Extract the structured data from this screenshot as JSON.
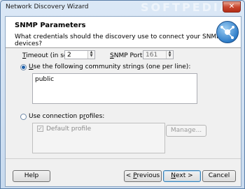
{
  "window": {
    "title": "Network Discovery Wizard",
    "watermark": "SOFTPEDIA",
    "close_glyph": "✕"
  },
  "header": {
    "title": "SNMP Parameters",
    "subtitle": "What credentials should the discovery use to connect your SNMP devices?"
  },
  "timeout": {
    "label_prefix": "",
    "label_u": "T",
    "label_rest": "imeout (in sec):",
    "value": "2"
  },
  "snmp_port": {
    "label_u": "S",
    "label_rest": "NMP Port:",
    "value": "161"
  },
  "community": {
    "label_u": "U",
    "label_rest": "se the following community strings (one per line):",
    "value": "public"
  },
  "profiles": {
    "label_pre": "Use connection p",
    "label_u": "r",
    "label_rest": "ofiles:",
    "items": [
      {
        "label": "Default profile",
        "checked": true
      }
    ],
    "manage_label": "Manage..."
  },
  "buttons": {
    "help": "Help",
    "previous_u": "P",
    "previous_rest": "revious",
    "previous_arrow": "<",
    "next_u": "N",
    "next_rest": "ext",
    "next_arrow": ">",
    "cancel": "Cancel"
  }
}
